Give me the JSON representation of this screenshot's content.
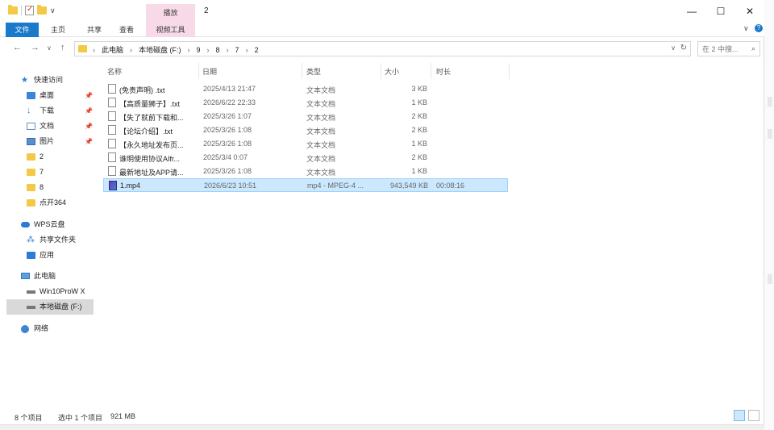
{
  "title_bar": {
    "context_tab_header": "播放",
    "window_title": "2",
    "buttons": {
      "minimize": "—",
      "maximize": "☐",
      "close": "✕"
    },
    "qat_arrow": "∨"
  },
  "ribbon": {
    "tabs": [
      "文件",
      "主页",
      "共享",
      "查看",
      "视频工具"
    ],
    "collapse_arrow": "∨",
    "help_icon": "?"
  },
  "address": {
    "back": "←",
    "forward": "→",
    "recent": "∨",
    "up": "↑",
    "breadcrumbs": [
      "此电脑",
      "本地磁盘 (F:)",
      "9",
      "8",
      "7",
      "2"
    ],
    "chevron": "›",
    "dropdown": "∨",
    "refresh": "↻",
    "search_placeholder": "在 2 中搜...",
    "search_icon": "⌕"
  },
  "nav_pane": {
    "quick_access": "快速访问",
    "desktop": "桌面",
    "downloads": "下载",
    "documents": "文档",
    "pictures": "图片",
    "folder_2": "2",
    "folder_7": "7",
    "folder_8": "8",
    "folder_dk": "点开364",
    "wps": "WPS云盘",
    "shared": "共享文件夹",
    "apps": "应用",
    "this_pc": "此电脑",
    "win10": "Win10ProW X",
    "local_f": "本地磁盘 (F:)",
    "network": "网络",
    "pin": "📌",
    "chevron": "›"
  },
  "columns": {
    "name": "名称",
    "date": "日期",
    "type": "类型",
    "size": "大小",
    "duration": "时长"
  },
  "files": [
    {
      "name": "(免责声明) .txt",
      "date": "2025/4/13 21:47",
      "type": "文本文档",
      "size": "3 KB",
      "duration": ""
    },
    {
      "name": "【高质量狮子】.txt",
      "date": "2026/6/22 22:33",
      "type": "文本文档",
      "size": "1 KB",
      "duration": ""
    },
    {
      "name": "【失了就前下载和...",
      "date": "2025/3/26 1:07",
      "type": "文本文档",
      "size": "2 KB",
      "duration": ""
    },
    {
      "name": "【论坛介绍】.txt",
      "date": "2025/3/26 1:08",
      "type": "文本文档",
      "size": "2 KB",
      "duration": ""
    },
    {
      "name": "【永久地址发布页...",
      "date": "2025/3/26 1:08",
      "type": "文本文档",
      "size": "1 KB",
      "duration": ""
    },
    {
      "name": "谁明使用协议AIfr...",
      "date": "2025/3/4 0:07",
      "type": "文本文档",
      "size": "2 KB",
      "duration": ""
    },
    {
      "name": "最新地址及APP请...",
      "date": "2025/3/26 1:08",
      "type": "文本文档",
      "size": "1 KB",
      "duration": ""
    },
    {
      "name": "1.mp4",
      "date": "2026/6/23 10:51",
      "type": "mp4 - MPEG-4 ...",
      "size": "943,549 KB",
      "duration": "00:08:16"
    }
  ],
  "status": {
    "count": "8 个项目",
    "selected": "选中 1 个项目",
    "size": "921 MB"
  }
}
